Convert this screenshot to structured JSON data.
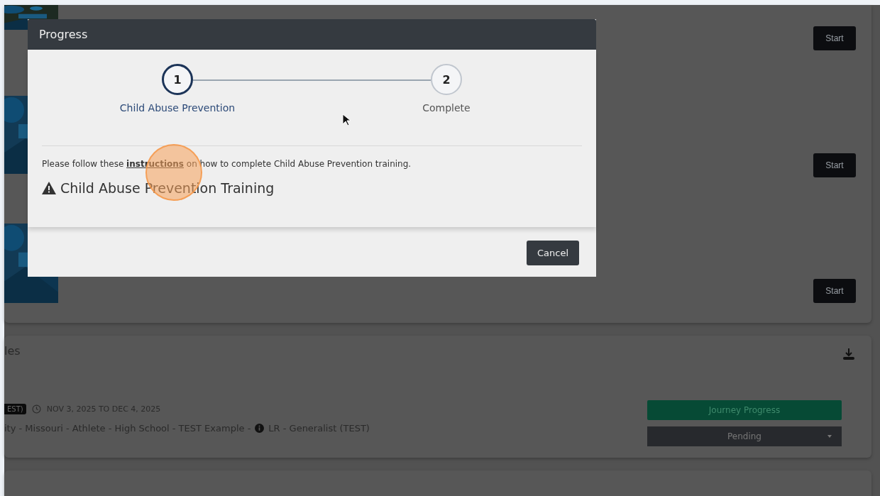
{
  "background": {
    "task_rows": [
      {
        "button": "Start"
      },
      {
        "button": "Start"
      },
      {
        "button": "Start"
      }
    ],
    "schedule_card": {
      "title": "les",
      "tag": "EST)",
      "date_range": "NOV 3, 2025 TO DEC 4, 2025",
      "path": "ity - Missouri - Athlete - High School - TEST Example - ",
      "role": "LR - Generalist (TEST)",
      "progress_button": "Journey Progress",
      "status_dropdown": "Pending"
    }
  },
  "dialog": {
    "title": "Progress",
    "steps": [
      {
        "number": "1",
        "label": "Child Abuse Prevention",
        "selected": true
      },
      {
        "number": "2",
        "label": "Complete",
        "selected": false
      }
    ],
    "instruction": {
      "before": "Please follow these ",
      "link": "instructions",
      "after": " on how to complete Child Abuse Prevention training."
    },
    "heading": "Child Abuse Prevention Training",
    "buttons": [
      "Cancel"
    ]
  }
}
